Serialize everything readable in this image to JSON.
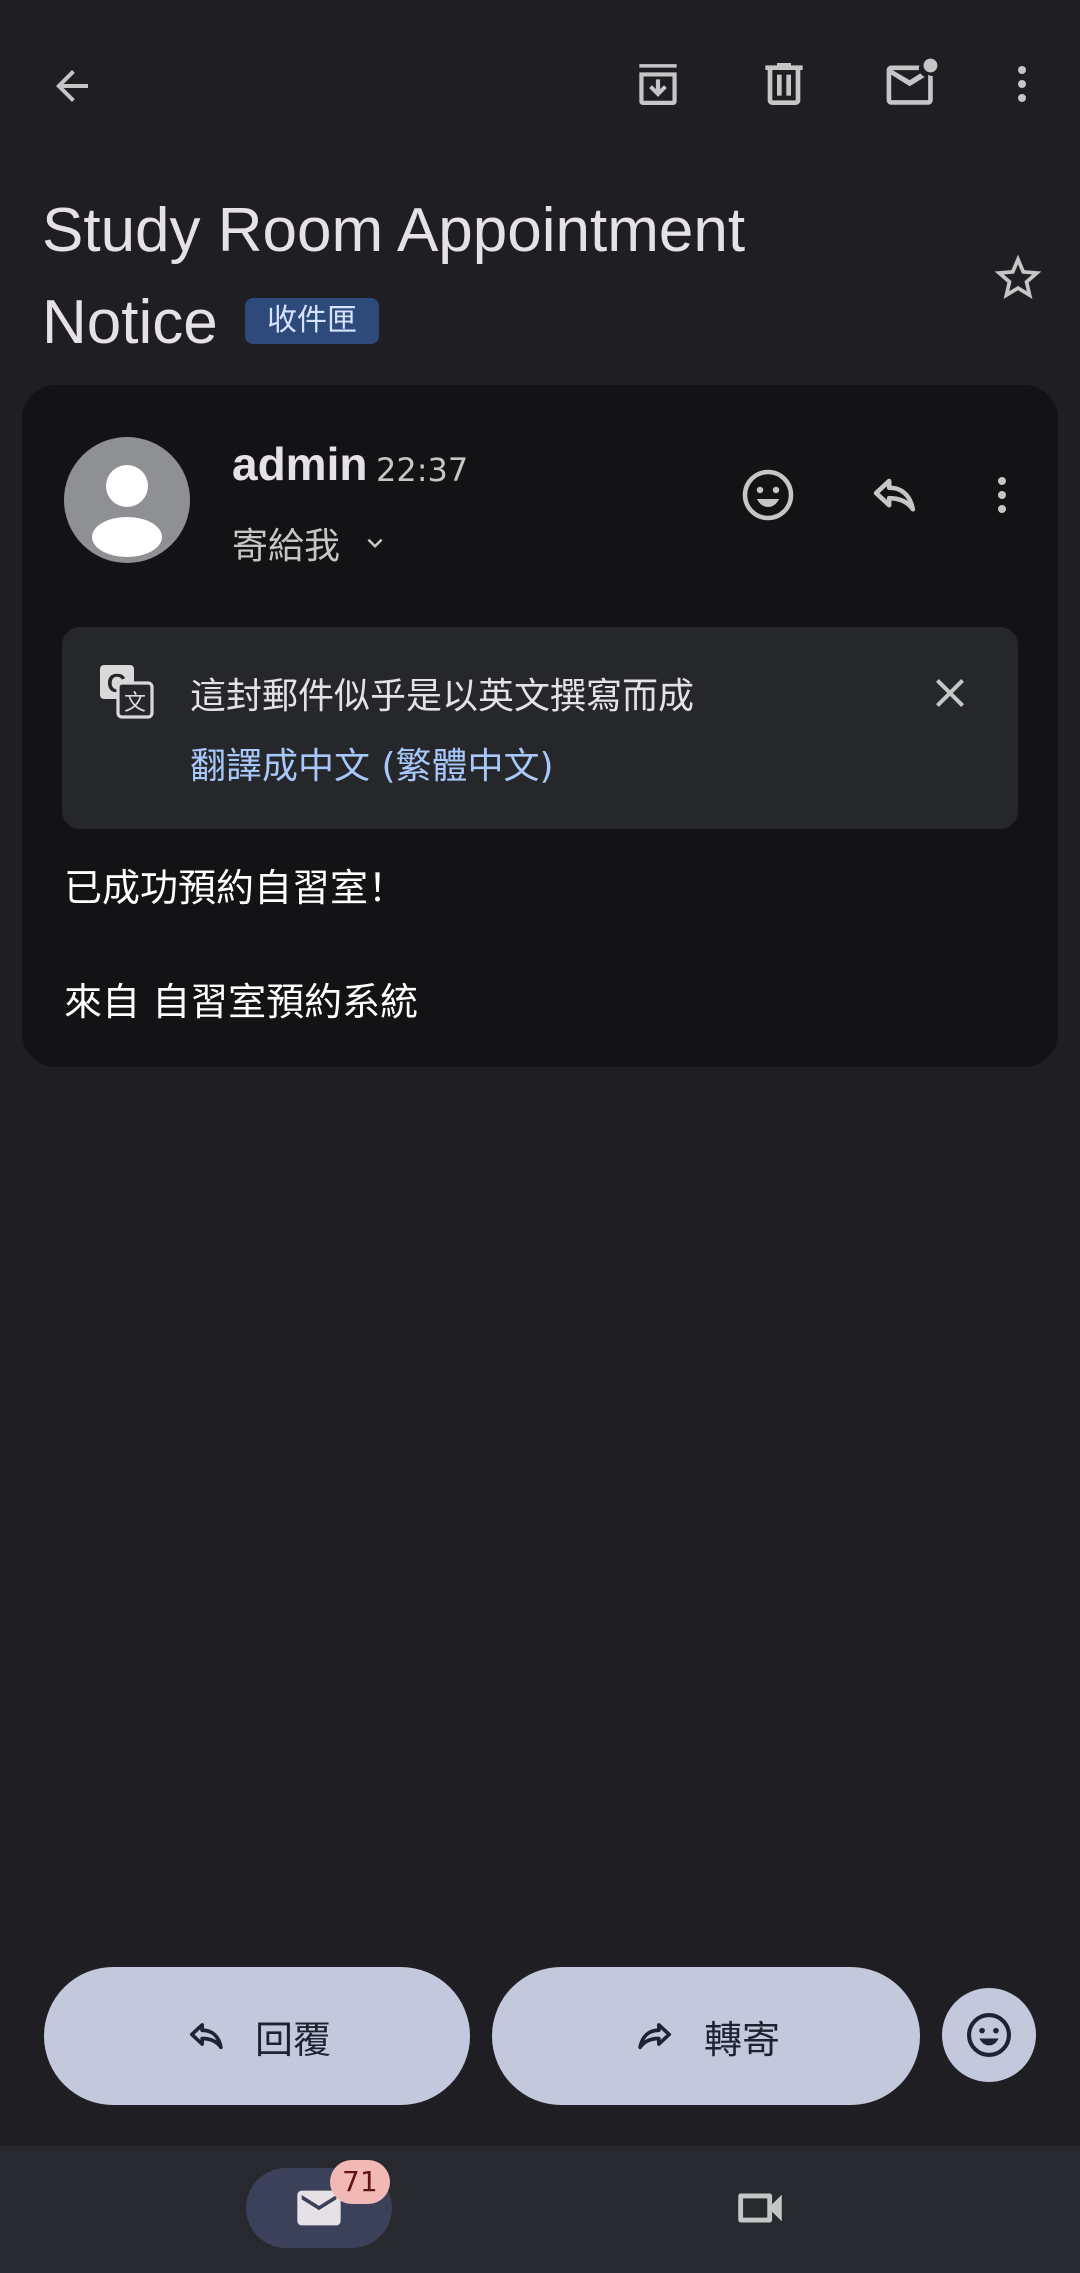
{
  "subject": {
    "title": "Study Room Appointment Notice",
    "label": "收件匣"
  },
  "message": {
    "sender": "admin",
    "time": "22:37",
    "recipient": "寄給我",
    "translate_notice": "這封郵件似乎是以英文撰寫而成",
    "translate_link": "翻譯成中文 (繁體中文)",
    "body": [
      "已成功預約自習室！",
      "來自 自習室預約系統"
    ]
  },
  "actions": {
    "reply_label": "回覆",
    "forward_label": "轉寄"
  },
  "bottom_nav": {
    "mail_badge": "71"
  },
  "icons": {
    "top_bar": [
      "back-arrow-icon",
      "archive-icon",
      "delete-icon",
      "mark-unread-icon",
      "more-vert-icon"
    ],
    "star": "star-outline-icon",
    "message_actions": [
      "add-reaction-icon",
      "reply-icon",
      "more-vert-icon"
    ],
    "translate": "google-translate-icon",
    "dismiss": "close-icon",
    "nav": [
      "mail-icon",
      "video-camera-icon"
    ]
  },
  "colors": {
    "background": "#1f1f23",
    "card": "#131316",
    "label_chip": "#2e4a7b",
    "link": "#a8c7fa",
    "pill": "#c3c8dd",
    "badge": "#f2b8b5"
  }
}
